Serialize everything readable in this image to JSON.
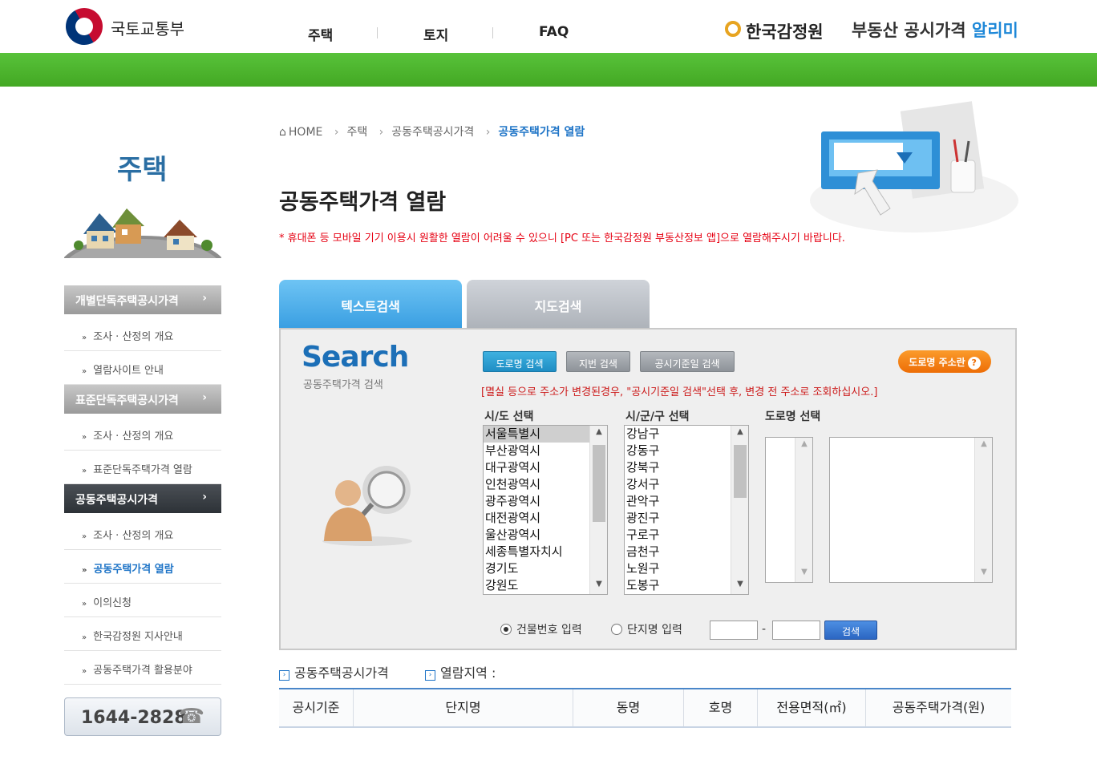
{
  "header": {
    "gov_name": "국토교통부",
    "nav": [
      "주택",
      "토지",
      "FAQ"
    ],
    "org_name": "한국감정원",
    "service_title_1": "부동산 공시가격 ",
    "service_title_2": "알리미"
  },
  "sidebar": {
    "title": "주택",
    "categories": [
      {
        "label": "개별단독주택공시가격",
        "arrow": "›",
        "items": [
          "조사 · 산정의 개요",
          "열람사이트 안내"
        ]
      },
      {
        "label": "표준단독주택공시가격",
        "arrow": "›",
        "items": [
          "조사 · 산정의 개요",
          "표준단독주택가격 열람"
        ]
      },
      {
        "label": "공동주택공시가격",
        "arrow": "›",
        "items": [
          "조사 · 산정의 개요",
          "공동주택가격 열람",
          "이의신청",
          "한국감정원 지사안내",
          "공동주택가격 활용분야"
        ]
      }
    ],
    "phone": "1644-2828"
  },
  "breadcrumb": {
    "home": "HOME",
    "items": [
      "주택",
      "공동주택공시가격",
      "공동주택가격 열람"
    ]
  },
  "page_title": "공동주택가격 열람",
  "notice": "* 휴대폰 등 모바일 기기 이용시 원활한 열람이 어려울 수 있으니 [PC 또는 한국감정원 부동산정보 앱]으로 열람해주시기 바랍니다.",
  "tabs": [
    "텍스트검색",
    "지도검색"
  ],
  "search": {
    "logo": "Search",
    "logo_sub": "공동주택가격 검색",
    "buttons": [
      "도로명 검색",
      "지번 검색",
      "공시기준일 검색"
    ],
    "guide_button": "도로명 주소란",
    "guide_q": "?",
    "warning": "[멸실 등으로 주소가 변경된경우, \"공시기준일 검색\"선택 후, 변경 전 주소로 조회하십시오.]",
    "labels": [
      "시/도 선택",
      "시/군/구 선택",
      "도로명 선택"
    ],
    "sido": [
      "서울특별시",
      "부산광역시",
      "대구광역시",
      "인천광역시",
      "광주광역시",
      "대전광역시",
      "울산광역시",
      "세종특별자치시",
      "경기도",
      "강원도"
    ],
    "sido_selected": "서울특별시",
    "sigungu": [
      "강남구",
      "강동구",
      "강북구",
      "강서구",
      "관악구",
      "광진구",
      "구로구",
      "금천구",
      "노원구",
      "도봉구"
    ],
    "radio_building": "건물번호 입력",
    "radio_complex": "단지명 입력",
    "radio_selected": "building",
    "dash": "-",
    "search_button": "검색"
  },
  "results": {
    "label1": "공동주택공시가격",
    "label2": "열람지역 :",
    "columns": [
      "공시기준",
      "단지명",
      "동명",
      "호명",
      "전용면적(㎡)",
      "공동주택가격(원)"
    ]
  },
  "colors": {
    "green": "#4cb52e",
    "blue_accent": "#1e74c7",
    "notice_red": "#e60012",
    "tab_active": "#3a9fe2",
    "orange": "#ed6d06"
  }
}
